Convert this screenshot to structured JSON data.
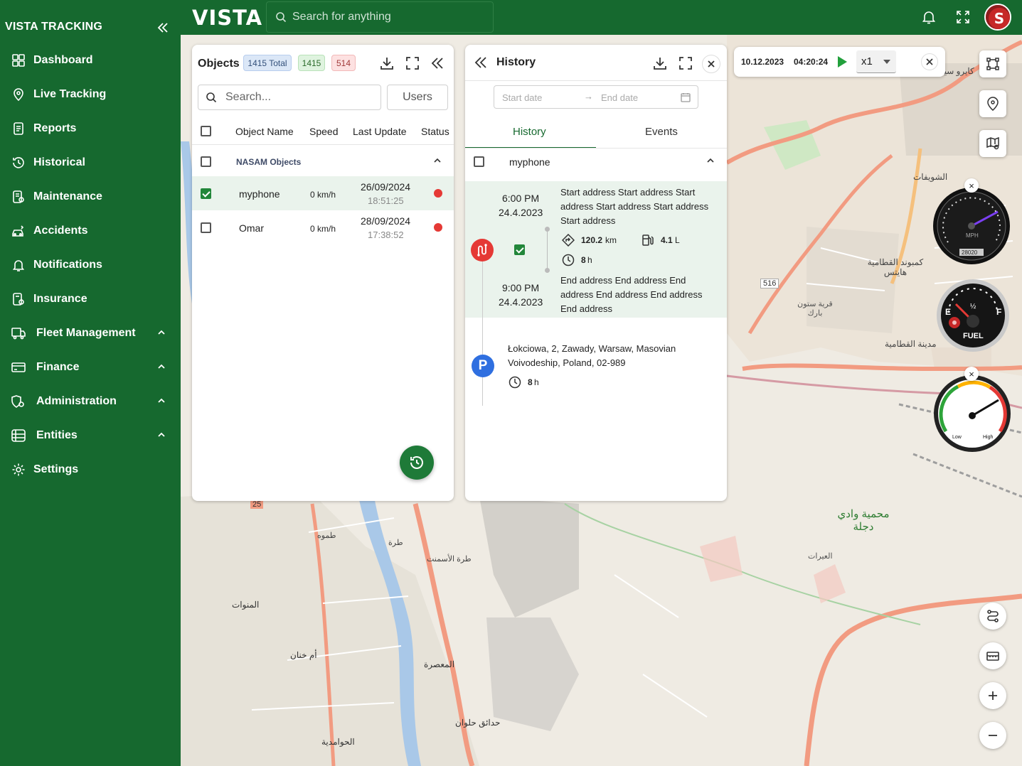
{
  "app": {
    "brand": "VISTA TRACKING",
    "logo": "VISTA",
    "accent": "#16692f"
  },
  "search": {
    "placeholder": "Search for anything"
  },
  "sidebar": {
    "items": [
      {
        "label": "Dashboard",
        "icon": "grid-icon"
      },
      {
        "label": "Live Tracking",
        "icon": "location-icon"
      },
      {
        "label": "Reports",
        "icon": "report-icon"
      },
      {
        "label": "Historical",
        "icon": "history-icon"
      },
      {
        "label": "Maintenance",
        "icon": "maintenance-icon"
      },
      {
        "label": "Accidents",
        "icon": "accident-icon"
      },
      {
        "label": "Notifications",
        "icon": "bell-icon"
      },
      {
        "label": "Insurance",
        "icon": "insurance-icon"
      },
      {
        "label": "Fleet Management",
        "icon": "car-icon"
      },
      {
        "label": "Finance",
        "icon": "card-icon"
      },
      {
        "label": "Administration",
        "icon": "admin-icon"
      },
      {
        "label": "Entities",
        "icon": "entities-icon"
      },
      {
        "label": "Settings",
        "icon": "gear-icon"
      }
    ]
  },
  "objects": {
    "title": "Objects",
    "total": "1415 Total",
    "online": "1415",
    "offline": "514",
    "search_placeholder": "Search...",
    "users_button": "Users",
    "columns": [
      "Object Name",
      "Speed",
      "Last Update",
      "Status"
    ],
    "group": "NASAM Objects",
    "rows": [
      {
        "name": "myphone",
        "speed": "0 km/h",
        "date": "26/09/2024",
        "time": "18:51:25",
        "status_color": "#e53935"
      },
      {
        "name": "Omar",
        "speed": "0 km/h",
        "date": "28/09/2024",
        "time": "17:38:52",
        "status_color": "#e53935"
      }
    ]
  },
  "history": {
    "title": "History",
    "start_placeholder": "Start date",
    "end_placeholder": "End date",
    "tabs": [
      "History",
      "Events"
    ],
    "device": "myphone",
    "trip": {
      "start_time": "6:00 PM",
      "start_date": "24.4.2023",
      "start_address": "Start address Start address Start address Start address Start address Start address",
      "distance_value": "120.2",
      "distance_unit": "km",
      "fuel_value": "4.1",
      "fuel_unit": "L",
      "duration_value": "8",
      "duration_unit": "h",
      "end_time": "9:00 PM",
      "end_date": "24.4.2023",
      "end_address": "End address End address End address End address End address End address"
    },
    "parking": {
      "marker": "P",
      "address": "Łokciowa, 2, Zawady, Warsaw, Masovian Voivodeship, Poland, 02-989",
      "duration_value": "8",
      "duration_unit": "h"
    }
  },
  "playback": {
    "date": "10.12.2023",
    "time": "04:20:24",
    "speed": "x1"
  },
  "gauges": {
    "speedometer": {
      "unit": "MPH",
      "odometer": "28020"
    },
    "fuel": {
      "label": "FUEL",
      "empty": "E",
      "half": "½",
      "full": "F"
    },
    "level": {
      "low": "Low",
      "high": "High"
    }
  },
  "map": {
    "labels": [
      "كايرو سيتي",
      "الشويفات",
      "كمبوند القطامية هايتس",
      "مدينة القطامية",
      "قرية ستون بارك",
      "محمية وادي دجلة",
      "العيرات",
      "طرة الأسمنت",
      "طرة",
      "طموه",
      "المنوات",
      "أم خنان",
      "المعصرة",
      "حدائق حلوان",
      "الحوامدية"
    ],
    "route_badges": [
      "516",
      "25"
    ]
  }
}
